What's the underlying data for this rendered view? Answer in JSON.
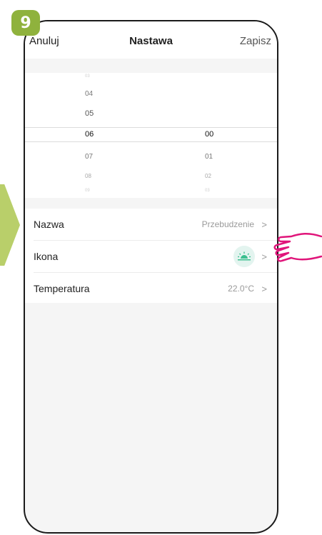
{
  "step": {
    "number": "9"
  },
  "header": {
    "cancel": "Anuluj",
    "title": "Nastawa",
    "save": "Zapisz"
  },
  "picker": {
    "hours": {
      "faint_top": "03",
      "above2": "04",
      "above1": "05",
      "selected": "06",
      "below1": "07",
      "below2": "08",
      "faint_bottom": "09"
    },
    "minutes": {
      "selected": "00",
      "below1": "01",
      "below2": "02",
      "faint_bottom": "03"
    }
  },
  "settings": {
    "name": {
      "label": "Nazwa",
      "value": "Przebudzenie"
    },
    "icon": {
      "label": "Ikona",
      "icon_name": "sunrise-icon",
      "icon_color": "#3bbf8f"
    },
    "temperature": {
      "label": "Temperatura",
      "value": "22.0°C"
    }
  },
  "colors": {
    "badge": "#8fb23d",
    "arrow": "#b9cf6a",
    "hand": "#e0157a"
  }
}
